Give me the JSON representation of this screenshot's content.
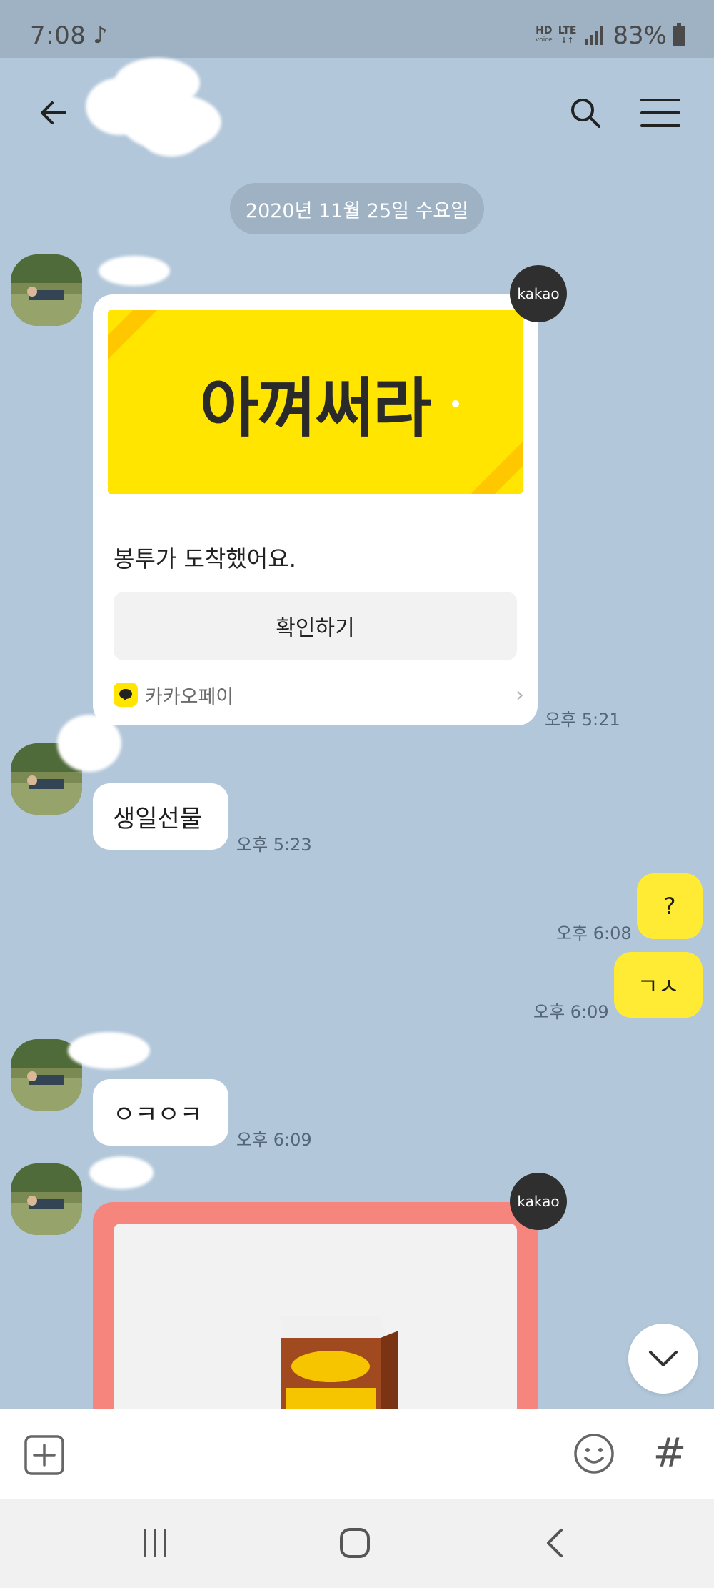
{
  "status_bar": {
    "time": "7:08",
    "note_icon": "music-note-icon",
    "network_top": "HD",
    "network_sub": "voice",
    "lte_label": "LTE",
    "battery": "83%"
  },
  "header": {
    "back_icon": "back-arrow-icon",
    "search_icon": "search-icon",
    "menu_icon": "hamburger-menu-icon"
  },
  "chat": {
    "date_divider": "2020년 11월 25일 수요일",
    "messages": [
      {
        "type": "kakaopay_card",
        "banner_text": "아껴써라",
        "body": "봉투가 도착했어요.",
        "button": "확인하기",
        "footer_brand": "카카오페이",
        "badge": "kakao",
        "time": "오후 5:21"
      },
      {
        "type": "text_in",
        "text": "생일선물",
        "time": "오후 5:23"
      },
      {
        "type": "text_out",
        "text": "?",
        "time": "오후 6:08"
      },
      {
        "type": "text_out",
        "text": "ㄱㅅ",
        "time": "오후 6:09"
      },
      {
        "type": "text_in",
        "text": "ㅇㅋㅇㅋ",
        "time": "오후 6:09"
      },
      {
        "type": "gift_card",
        "badge": "kakao"
      }
    ]
  },
  "input_bar": {
    "plus_icon": "plus-box-icon",
    "emoji_icon": "emoji-icon",
    "hash_label": "#"
  },
  "colors": {
    "chat_bg": "#b2c7da",
    "my_bubble": "#ffeb33",
    "kakao_yellow": "#ffe500"
  }
}
